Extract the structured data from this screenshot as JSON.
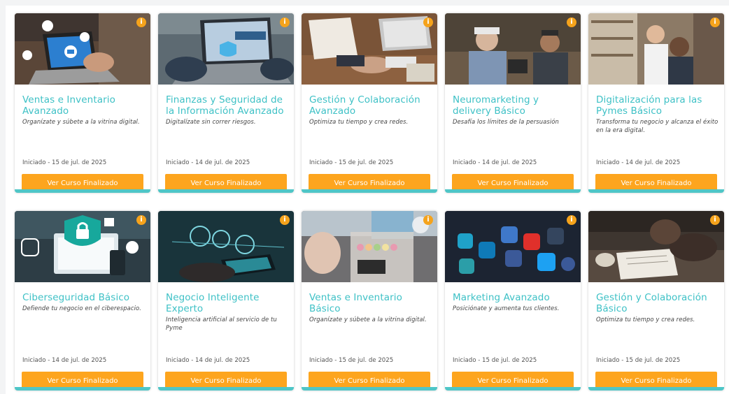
{
  "info_glyph": "i",
  "colors": {
    "title": "#3ec1c6",
    "button": "#fda51e",
    "bottom_bar": "#4fc6c7",
    "info_badge": "#f5a31c"
  },
  "courses": [
    {
      "title": "Ventas e Inventario Avanzado",
      "description": "Organízate y súbete a la vitrina digital.",
      "date": "Iniciado - 15 de jul. de 2025",
      "button": "Ver Curso Finalizado",
      "image": "laptop-shopping-photo"
    },
    {
      "title": "Finanzas y Seguridad de la Información Avanzado",
      "description": "Digitalízate sin correr riesgos.",
      "date": "Iniciado - 14 de jul. de 2025",
      "button": "Ver Curso Finalizado",
      "image": "cyber-security-laptop-photo"
    },
    {
      "title": "Gestión y Colaboración Avanzado",
      "description": "Optimiza tu tiempo y crea redes.",
      "date": "Iniciado - 15 de jul. de 2025",
      "button": "Ver Curso Finalizado",
      "image": "handshake-desk-photo"
    },
    {
      "title": "Neuromarketing y delivery Básico",
      "description": "Desafía los límites de la persuasión",
      "date": "Iniciado - 14 de jul. de 2025",
      "button": "Ver Curso Finalizado",
      "image": "shop-owners-tablet-photo"
    },
    {
      "title": "Digitalización para las Pymes Básico",
      "description": "Transforma tu negocio y alcanza el éxito en la era digital.",
      "date": "Iniciado - 14 de jul. de 2025",
      "button": "Ver Curso Finalizado",
      "image": "store-customers-photo"
    },
    {
      "title": "Ciberseguridad Básico",
      "description": "Defiende tu negocio en el ciberespacio.",
      "date": "Iniciado - 14 de jul. de 2025",
      "button": "Ver Curso Finalizado",
      "image": "padlock-devices-photo"
    },
    {
      "title": "Negocio Inteligente Experto",
      "description": "Inteligencia artificial al servicio de tu Pyme",
      "date": "Iniciado - 14 de jul. de 2025",
      "button": "Ver Curso Finalizado",
      "image": "digital-tablet-icons-photo"
    },
    {
      "title": "Ventas e Inventario Básico",
      "description": "Organízate y súbete a la vitrina digital.",
      "date": "Iniciado - 15 de jul. de 2025",
      "button": "Ver Curso Finalizado",
      "image": "bakery-counter-photo"
    },
    {
      "title": "Marketing Avanzado",
      "description": "Posiciónate y aumenta tus clientes.",
      "date": "Iniciado - 15 de jul. de 2025",
      "button": "Ver Curso Finalizado",
      "image": "social-media-apps-photo"
    },
    {
      "title": "Gestión y Colaboración Básico",
      "description": "Optimiza tu tiempo y crea redes.",
      "date": "Iniciado - 15 de jul. de 2025",
      "button": "Ver Curso Finalizado",
      "image": "meeting-notes-photo"
    }
  ]
}
